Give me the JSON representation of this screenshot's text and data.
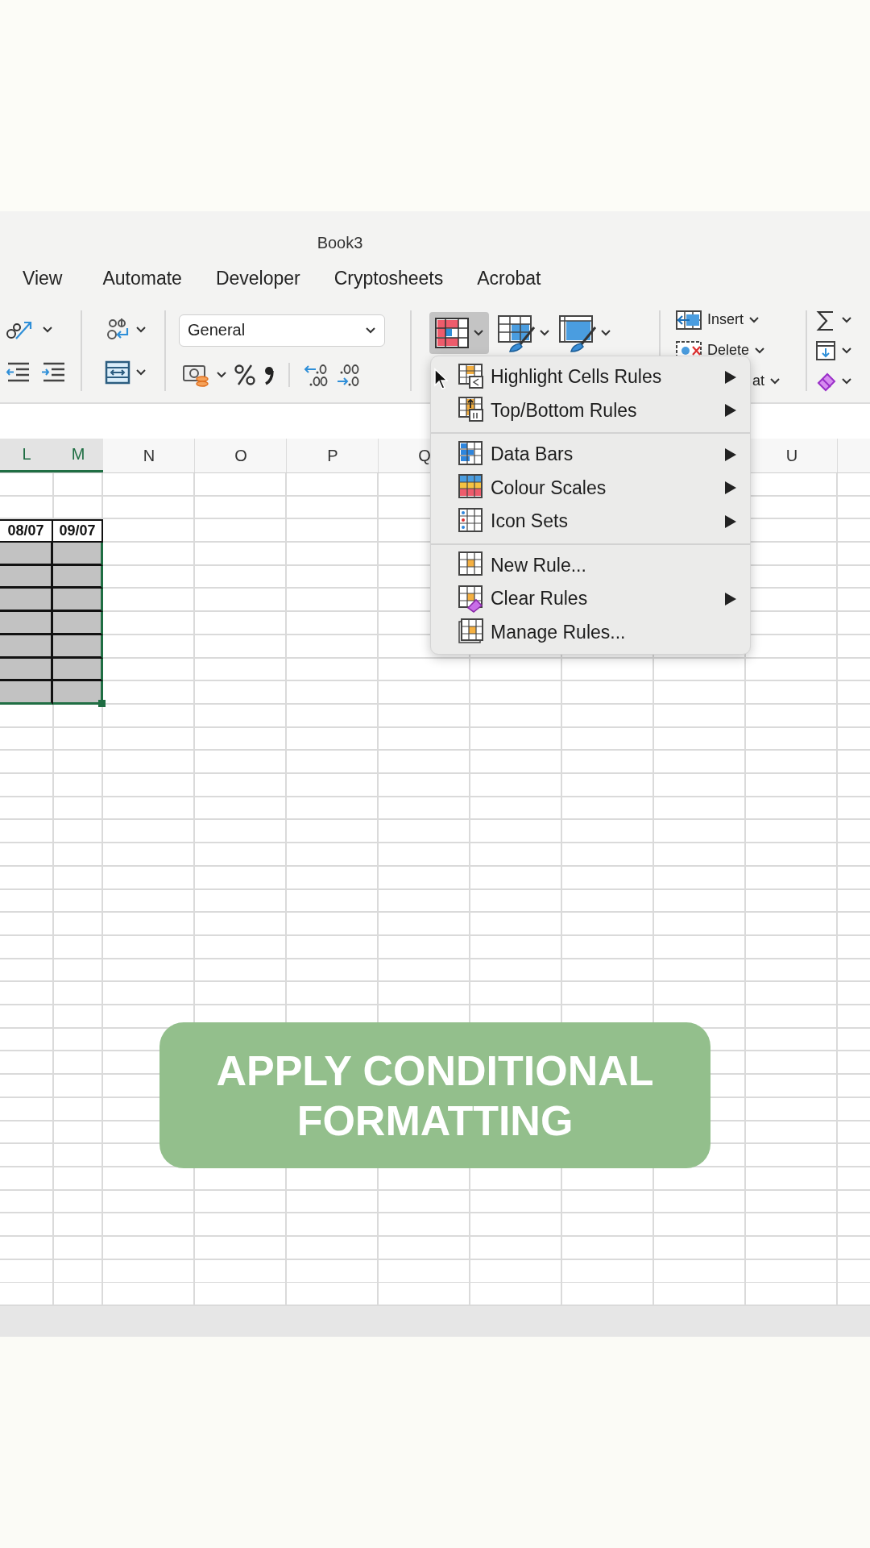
{
  "window": {
    "title": "Book3"
  },
  "tabs": [
    {
      "label": "View"
    },
    {
      "label": "Automate"
    },
    {
      "label": "Developer"
    },
    {
      "label": "Cryptosheets"
    },
    {
      "label": "Acrobat"
    }
  ],
  "ribbon": {
    "number_format": {
      "value": "General"
    },
    "conditional_formatting_button": {
      "pressed": true
    },
    "cells_group": [
      {
        "label": "Insert"
      },
      {
        "label": "Delete"
      },
      {
        "label": "at"
      }
    ]
  },
  "conditional_formatting_menu": {
    "sections": [
      [
        {
          "label": "Highlight Cells Rules",
          "submenu": true
        },
        {
          "label": "Top/Bottom Rules",
          "submenu": true
        }
      ],
      [
        {
          "label": "Data Bars",
          "submenu": true
        },
        {
          "label": "Colour Scales",
          "submenu": true
        },
        {
          "label": "Icon Sets",
          "submenu": true
        }
      ],
      [
        {
          "label": "New Rule...",
          "submenu": false
        },
        {
          "label": "Clear Rules",
          "submenu": true
        },
        {
          "label": "Manage Rules...",
          "submenu": false
        }
      ]
    ]
  },
  "sheet": {
    "columns": [
      {
        "label": "L",
        "selected": true
      },
      {
        "label": "M",
        "selected": true
      },
      {
        "label": "N",
        "selected": false
      },
      {
        "label": "O",
        "selected": false
      },
      {
        "label": "P",
        "selected": false
      },
      {
        "label": "Q",
        "selected": false
      },
      {
        "label": "U",
        "selected": false
      }
    ],
    "header_cells": [
      "08/07",
      "09/07"
    ],
    "body_rows": [
      {
        "shaded": true,
        "selected": true
      },
      {
        "shaded": true,
        "selected": true
      },
      {
        "shaded": true,
        "selected": true
      },
      {
        "shaded": true,
        "selected": true
      },
      {
        "shaded": true,
        "selected": true
      },
      {
        "shaded": true,
        "selected": true
      },
      {
        "shaded": true,
        "selected": true
      }
    ]
  },
  "caption": {
    "text": "APPLY CONDITIONAL FORMATTING"
  }
}
